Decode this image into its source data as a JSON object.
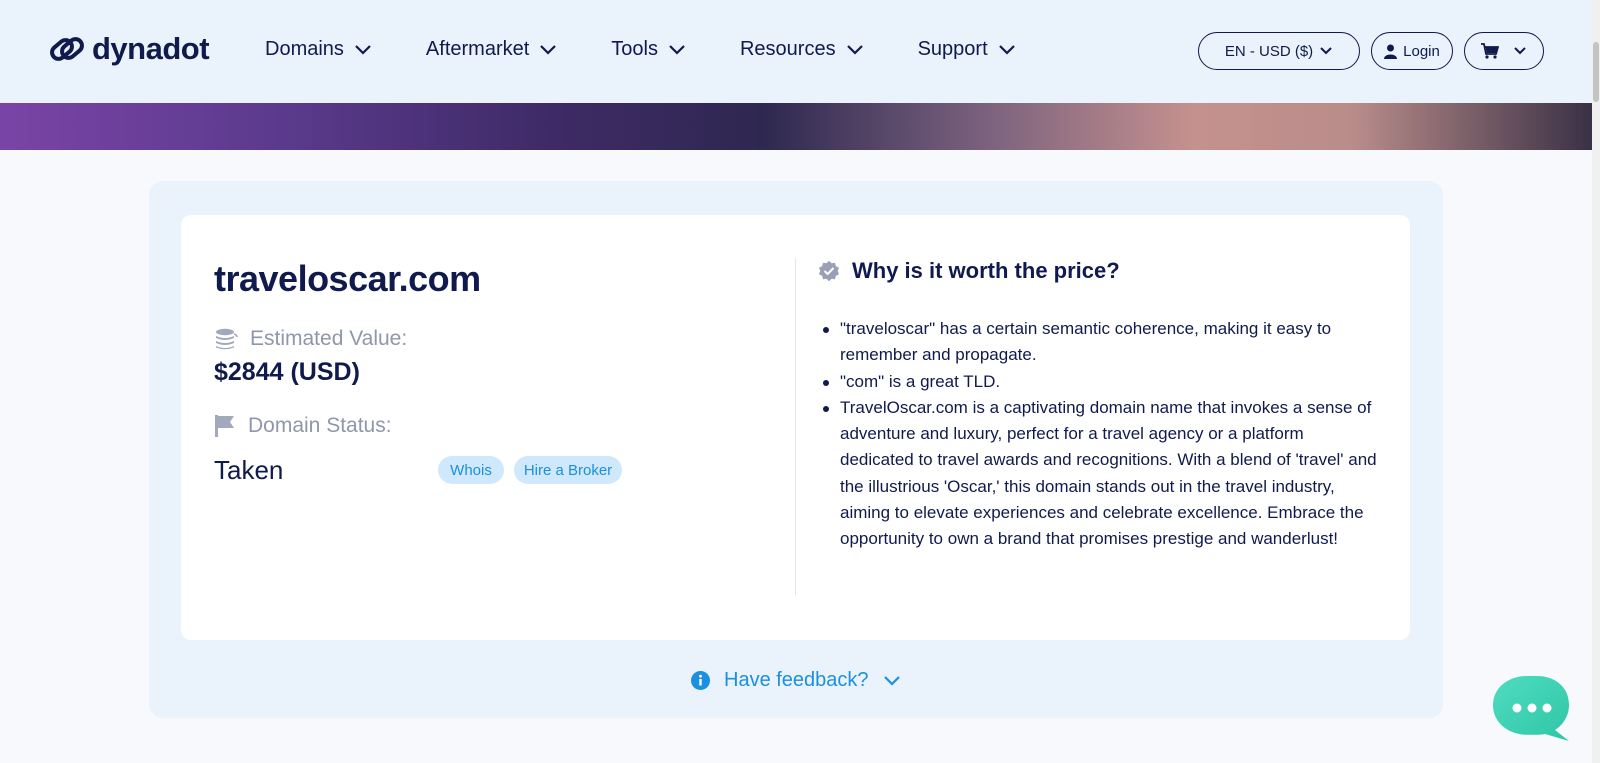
{
  "header": {
    "brand": "dynadot",
    "nav": [
      {
        "label": "Domains"
      },
      {
        "label": "Aftermarket"
      },
      {
        "label": "Tools"
      },
      {
        "label": "Resources"
      },
      {
        "label": "Support"
      }
    ],
    "language_currency": "EN - USD ($)",
    "login": "Login"
  },
  "domain": {
    "name": "traveloscar.com",
    "estimated_value_label": "Estimated Value:",
    "estimated_value": "$2844 (USD)",
    "status_label": "Domain Status:",
    "status_value": "Taken",
    "whois_label": "Whois",
    "broker_label": "Hire a Broker"
  },
  "why": {
    "title": "Why is it worth the price?",
    "reasons": [
      "\"traveloscar\" has a certain semantic coherence, making it easy to remember and propagate.",
      "\"com\" is a great TLD.",
      "TravelOscar.com is a captivating domain name that invokes a sense of adventure and luxury, perfect for a travel agency or a platform dedicated to travel awards and recognitions. With a blend of 'travel' and the illustrious 'Oscar,' this domain stands out in the travel industry, aiming to elevate experiences and celebrate excellence. Embrace the opportunity to own a brand that promises prestige and wanderlust!"
    ]
  },
  "feedback": {
    "label": "Have feedback?"
  },
  "colors": {
    "navy": "#101a4c",
    "accent_blue": "#1b8fe0",
    "chat_teal": "#3fd2b2",
    "header_bg": "#eaf2fc"
  }
}
